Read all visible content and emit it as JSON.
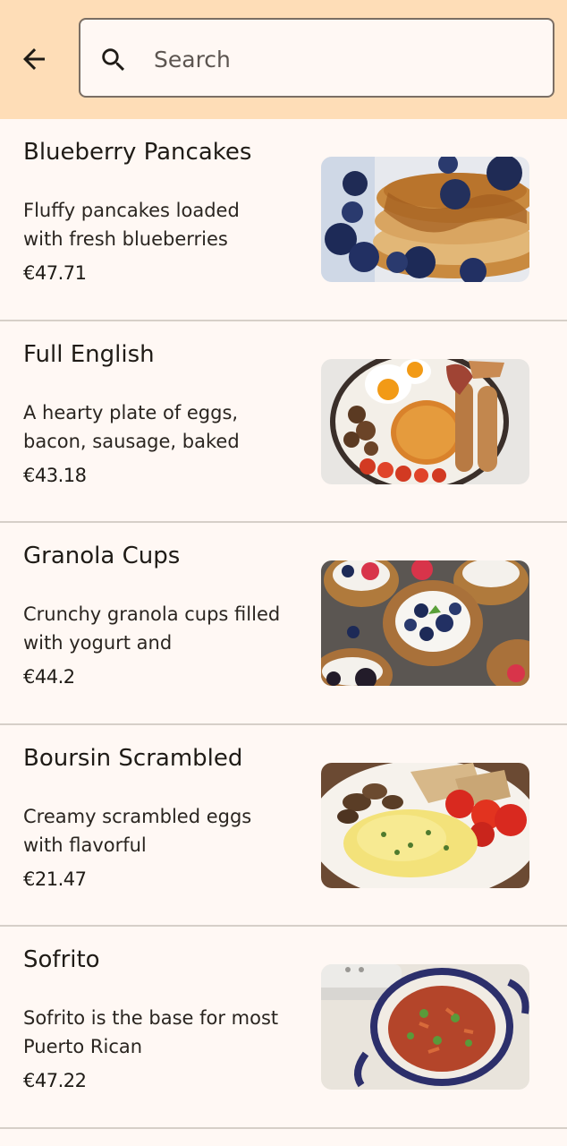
{
  "search": {
    "placeholder": "Search",
    "value": ""
  },
  "items": [
    {
      "title": "Blueberry Pancakes",
      "description": "Fluffy pancakes loaded with fresh blueberries",
      "price": "€47.71",
      "image": "blueberry-pancakes-photo"
    },
    {
      "title": "Full English",
      "description": "A hearty plate of eggs, bacon, sausage, baked",
      "price": "€43.18",
      "image": "full-english-photo"
    },
    {
      "title": "Granola Cups",
      "description": "Crunchy granola cups filled with yogurt and",
      "price": "€44.2",
      "image": "granola-cups-photo"
    },
    {
      "title": "Boursin Scrambled",
      "description": "Creamy scrambled eggs with flavorful",
      "price": "€21.47",
      "image": "boursin-scrambled-photo"
    },
    {
      "title": "Sofrito",
      "description": "Sofrito is the base for most Puerto Rican",
      "price": "€47.22",
      "image": "sofrito-photo"
    }
  ],
  "colors": {
    "header": "#FEDDB7",
    "background": "#FFF8F4",
    "divider": "#D6CFC8"
  },
  "icons": {
    "back": "arrow-left-icon",
    "search": "search-icon"
  }
}
